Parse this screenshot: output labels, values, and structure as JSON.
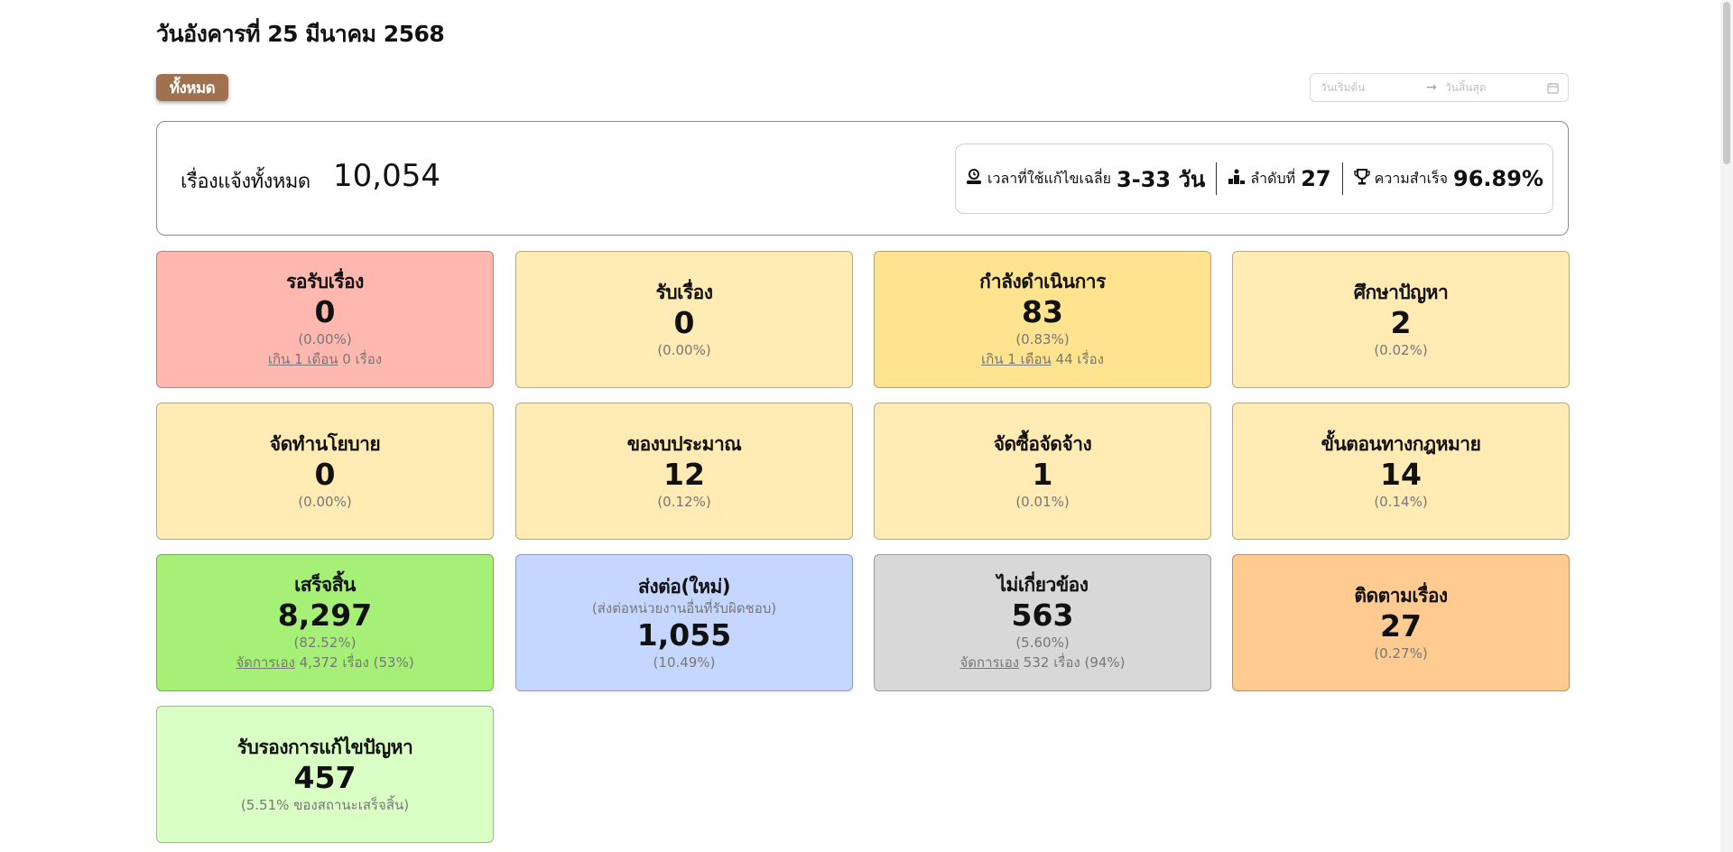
{
  "header": {
    "date_title": "วันอังคารที่ 25 มีนาคม 2568"
  },
  "filter": {
    "all_label": "ทั้งหมด"
  },
  "date_range": {
    "start_placeholder": "วันเริ่มต้น",
    "arrow": "→",
    "end_placeholder": "วันสิ้นสุด"
  },
  "summary": {
    "label": "เรื่องแจ้งทั้งหมด",
    "total": "10,054",
    "avg_time_label": "เวลาที่ใช้แก้ไขเฉลี่ย",
    "avg_time_value": "3-33 วัน",
    "rank_label": "ลำดับที่",
    "rank_value": "27",
    "success_label": "ความสำเร็จ",
    "success_value": "96.89%"
  },
  "cards": {
    "pending": {
      "title": "รอรับเรื่อง",
      "value": "0",
      "percent": "(0.00%)",
      "overdue_link": "เกิน 1 เดือน",
      "overdue_count": " 0 เรื่อง"
    },
    "accepted": {
      "title": "รับเรื่อง",
      "value": "0",
      "percent": "(0.00%)"
    },
    "in_progress": {
      "title": "กำลังดำเนินการ",
      "value": "83",
      "percent": "(0.83%)",
      "overdue_link": "เกิน 1 เดือน",
      "overdue_count": " 44 เรื่อง"
    },
    "studying": {
      "title": "ศึกษาปัญหา",
      "value": "2",
      "percent": "(0.02%)"
    },
    "policy": {
      "title": "จัดทำนโยบาย",
      "value": "0",
      "percent": "(0.00%)"
    },
    "budget": {
      "title": "ของบประมาณ",
      "value": "12",
      "percent": "(0.12%)"
    },
    "procurement": {
      "title": "จัดซื้อจัดจ้าง",
      "value": "1",
      "percent": "(0.01%)"
    },
    "legal": {
      "title": "ขั้นตอนทางกฎหมาย",
      "value": "14",
      "percent": "(0.14%)"
    },
    "completed": {
      "title": "เสร็จสิ้น",
      "value": "8,297",
      "percent": "(82.52%)",
      "self_link": "จัดการเอง",
      "self_count": " 4,372 เรื่อง (53%)"
    },
    "forwarded": {
      "title": "ส่งต่อ(ใหม่)",
      "note": "(ส่งต่อหน่วยงานอื่นที่รับผิดชอบ)",
      "value": "1,055",
      "percent": "(10.49%)"
    },
    "unrelated": {
      "title": "ไม่เกี่ยวข้อง",
      "value": "563",
      "percent": "(5.60%)",
      "self_link": "จัดการเอง",
      "self_count": " 532 เรื่อง (94%)"
    },
    "follow_up": {
      "title": "ติดตามเรื่อง",
      "value": "27",
      "percent": "(0.27%)"
    },
    "certified": {
      "title": "รับรองการแก้ไขปัญหา",
      "value": "457",
      "percent": "(5.51% ของสถานะเสร็จสิ้น)"
    }
  },
  "colors": {
    "pending": "#ffb8b0",
    "light_yellow": "#ffebb3",
    "in_progress": "#ffe38e",
    "completed": "#a6f077",
    "forwarded": "#c6d7ff",
    "unrelated": "#d8d8d8",
    "follow_up": "#ffcb91",
    "certified": "#daffc4",
    "filter_button": "#a0714f"
  },
  "icons": [
    "clock-user-icon",
    "podium-icon",
    "trophy-icon",
    "calendar-icon"
  ]
}
